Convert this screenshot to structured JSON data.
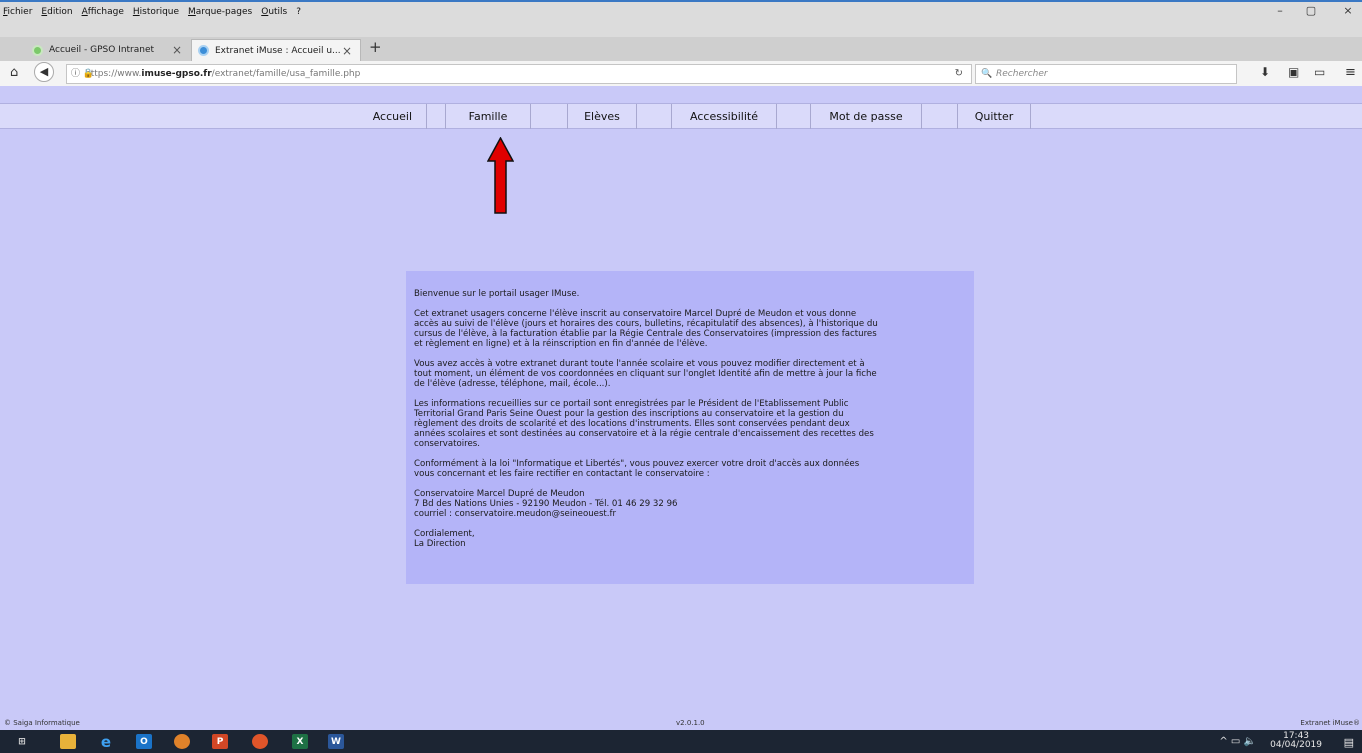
{
  "browser": {
    "menu": [
      "Fichier",
      "Edition",
      "Affichage",
      "Historique",
      "Marque-pages",
      "Outils",
      "?"
    ],
    "tabs": [
      {
        "label": "Accueil - GPSO Intranet",
        "close": "×"
      },
      {
        "label": "Extranet iMuse : Accueil u...",
        "close": "×"
      }
    ],
    "new_tab": "+",
    "url_prefix": "https://www.",
    "url_domain": "imuse-gpso.fr",
    "url_path": "/extranet/famille/usa_famille.php",
    "search_placeholder": "Rechercher",
    "window_controls": {
      "minimize": "–",
      "maximize": "▢",
      "close": "×"
    }
  },
  "nav": {
    "items": [
      "Accueil",
      "Famille",
      "Elèves",
      "Accessibilité",
      "Mot de passe",
      "Quitter"
    ]
  },
  "welcome": {
    "paragraphs": [
      "Bienvenue sur le portail usager IMuse.",
      "Cet extranet usagers concerne l'élève inscrit au conservatoire Marcel Dupré de Meudon et vous donne\naccès au suivi de l'élève (jours et horaires des cours, bulletins, récapitulatif des absences), à l'historique du\ncursus de l'élève, à la facturation établie par la Régie Centrale des Conservatoires (impression des factures\net règlement en ligne) et à la réinscription en fin d'année de l'élève.",
      "Vous avez accès à votre extranet durant toute l'année scolaire et vous pouvez modifier directement et à\ntout moment, un élément de vos coordonnées en cliquant sur l'onglet Identité afin de mettre à jour la fiche\nde l'élève (adresse, téléphone, mail, école...).",
      "Les informations recueillies sur ce portail sont enregistrées par le Président de l'Etablissement Public\nTerritorial Grand Paris Seine Ouest pour la gestion des inscriptions au conservatoire et la gestion du\nrèglement des droits de scolarité et des locations d'instruments. Elles sont conservées pendant deux\nannées scolaires et sont destinées au conservatoire et à la régie centrale d'encaissement des recettes des\nconservatoires.",
      "Conformément à la loi \"Informatique et Libertés\", vous pouvez exercer votre droit d'accès aux données\nvous concernant et les faire rectifier en contactant le conservatoire :",
      "Conservatoire Marcel Dupré de Meudon\n7 Bd des Nations Unies - 92190 Meudon - Tél. 01 46 29 32 96\ncourriel : conservatoire.meudon@seineouest.fr",
      "Cordialement,\nLa Direction"
    ]
  },
  "footer": {
    "left": "© Saiga Informatique",
    "center": "v2.0.1.0",
    "right": "Extranet iMuse®"
  },
  "taskbar": {
    "time": "17:43",
    "date": "04/04/2019"
  },
  "colors": {
    "page_bg": "#c9c9f8",
    "menu_bg": "#dadafa",
    "panel_bg": "#b4b4f8",
    "arrow": "#e00000",
    "taskbar": "#1c2533"
  }
}
